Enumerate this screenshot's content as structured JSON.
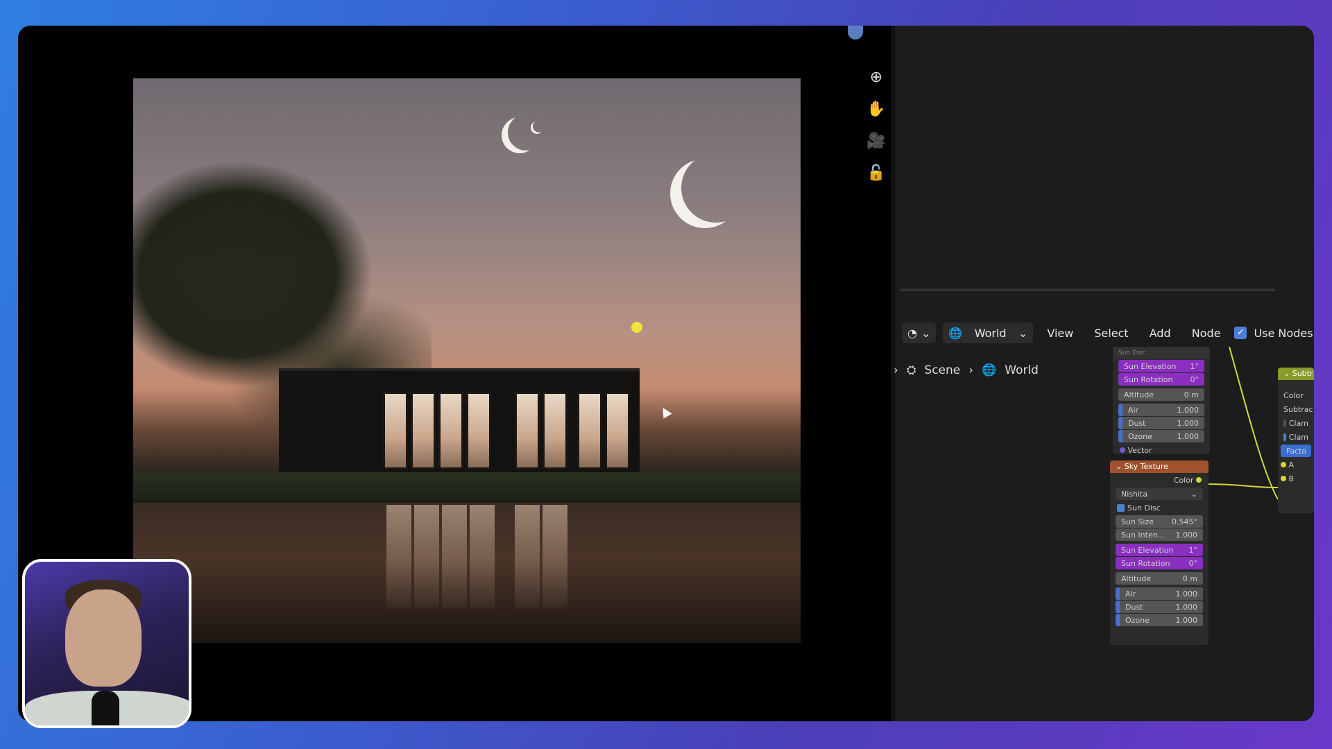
{
  "viewport_tools": [
    {
      "name": "zoom-icon",
      "glyph": "⊕"
    },
    {
      "name": "hand-icon",
      "glyph": "✋"
    },
    {
      "name": "camera-icon",
      "glyph": "🎥"
    },
    {
      "name": "lock-icon",
      "glyph": "🔓"
    }
  ],
  "header": {
    "editor_type_glyph": "◔",
    "world_label": "World",
    "menus": [
      "View",
      "Select",
      "Add",
      "Node"
    ],
    "use_nodes_label": "Use Nodes"
  },
  "breadcrumb": {
    "scene": "Scene",
    "world": "World"
  },
  "top_node_partial": {
    "title": "Sun Disc",
    "rows": [
      {
        "label": "Sun Elevation",
        "value": "1°",
        "style": "purple"
      },
      {
        "label": "Sun Rotation",
        "value": "0°",
        "style": "purple"
      },
      {
        "label": "Altitude",
        "value": "0 m",
        "style": "gray"
      },
      {
        "label": "Air",
        "value": "1.000",
        "style": "blue"
      },
      {
        "label": "Dust",
        "value": "1.000",
        "style": "blue"
      },
      {
        "label": "Ozone",
        "value": "1.000",
        "style": "blue"
      }
    ],
    "vector_label": "Vector"
  },
  "sky_node": {
    "title": "Sky Texture",
    "output_label": "Color",
    "sky_type": "Nishita",
    "sun_disc_label": "Sun Disc",
    "rows": [
      {
        "label": "Sun Size",
        "value": "0.545°",
        "style": "gray"
      },
      {
        "label": "Sun Inten...",
        "value": "1.000",
        "style": "gray"
      },
      {
        "label": "Sun Elevation",
        "value": "1°",
        "style": "purple"
      },
      {
        "label": "Sun Rotation",
        "value": "0°",
        "style": "purple"
      },
      {
        "label": "Altitude",
        "value": "0 m",
        "style": "gray"
      },
      {
        "label": "Air",
        "value": "1.000",
        "style": "blue"
      },
      {
        "label": "Dust",
        "value": "1.000",
        "style": "blue"
      },
      {
        "label": "Ozone",
        "value": "1.000",
        "style": "blue"
      }
    ]
  },
  "subtract_node": {
    "title": "Subtr",
    "rows": [
      "Color",
      "Subtrac",
      "Clam",
      "Clam",
      "Facto"
    ],
    "sockets": [
      "A",
      "B"
    ]
  },
  "colors": {
    "sky_head": "#a0522d",
    "subtract_head": "#8a9a2a",
    "link": "#d4d83a",
    "checkbox": "#4a7fd6",
    "purple": "#8a2fbf"
  }
}
